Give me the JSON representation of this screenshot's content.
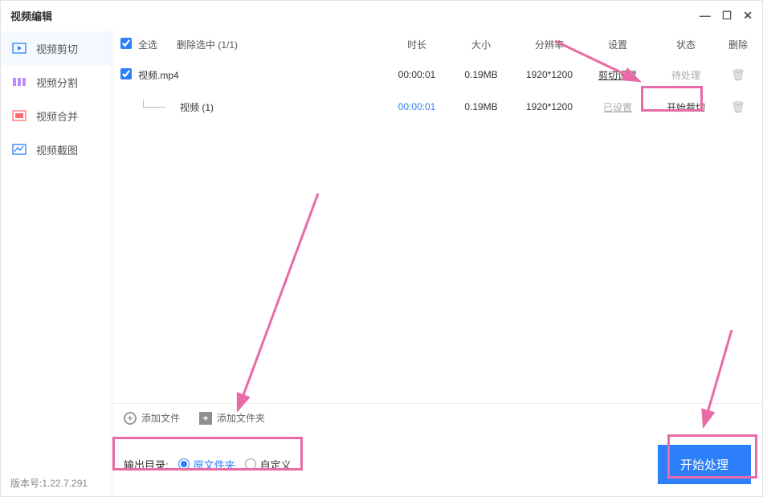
{
  "window": {
    "title": "视频编辑"
  },
  "sidebar": {
    "items": [
      {
        "label": "视频剪切",
        "icon": "cut"
      },
      {
        "label": "视频分割",
        "icon": "split"
      },
      {
        "label": "视频合并",
        "icon": "merge"
      },
      {
        "label": "视频截图",
        "icon": "shot"
      }
    ]
  },
  "table": {
    "select_all_label": "全选",
    "delete_selected_label": "删除选中 (1/1)",
    "headers": {
      "duration": "时长",
      "size": "大小",
      "resolution": "分辨率",
      "settings": "设置",
      "status": "状态",
      "delete": "删除"
    },
    "rows": [
      {
        "checked": true,
        "name": "视频.mp4",
        "duration": "00:00:01",
        "size": "0.19MB",
        "resolution": "1920*1200",
        "settings": "剪切设置",
        "status": "待处理"
      }
    ],
    "children": [
      {
        "name": "视频 (1)",
        "duration": "00:00:01",
        "size": "0.19MB",
        "resolution": "1920*1200",
        "settings": "已设置",
        "status": "开始裁切"
      }
    ]
  },
  "addbar": {
    "add_file": "添加文件",
    "add_folder": "添加文件夹"
  },
  "footer": {
    "output_dir_label": "输出目录:",
    "original_folder": "原文件夹",
    "custom": "自定义",
    "start_button": "开始处理"
  },
  "version_label": "版本号:1.22.7.291"
}
